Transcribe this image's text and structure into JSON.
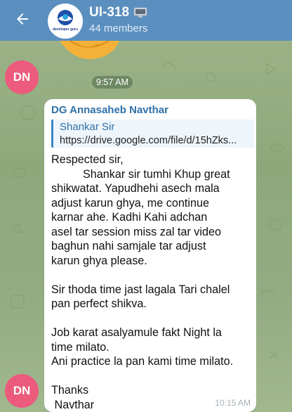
{
  "header": {
    "title": "UI-318",
    "title_icon": "computer-icon",
    "subtitle": "44 members",
    "logo_text": "developer guru",
    "color": "#5a8fbf"
  },
  "messages": [
    {
      "avatar_initials": "DN",
      "avatar_color": "#ec5a7c",
      "time": "9:57 AM"
    },
    {
      "avatar_initials": "DN",
      "sender": "DG Annasaheb Navthar",
      "reply": {
        "name": "Shankar Sir",
        "text": "https://drive.google.com/file/d/15hZks..."
      },
      "lines": [
        "Respected sir,",
        "          Shankar sir tumhi Khup great",
        "shikwatat. Yapudhehi asech mala",
        "adjust karun ghya, me continue",
        "karnar ahe. Kadhi Kahi adchan",
        "asel tar session miss zal tar video",
        "baghun nahi samjale tar adjust",
        "karun ghya please.",
        "",
        "Sir thoda time jast lagala Tari chalel",
        "pan perfect shikva.",
        "",
        "Job karat asalyamule fakt Night la",
        "time milato.",
        "Ani practice la pan kami time milato.",
        "",
        "Thanks",
        " Navthar"
      ],
      "time": "10:15 AM"
    }
  ]
}
